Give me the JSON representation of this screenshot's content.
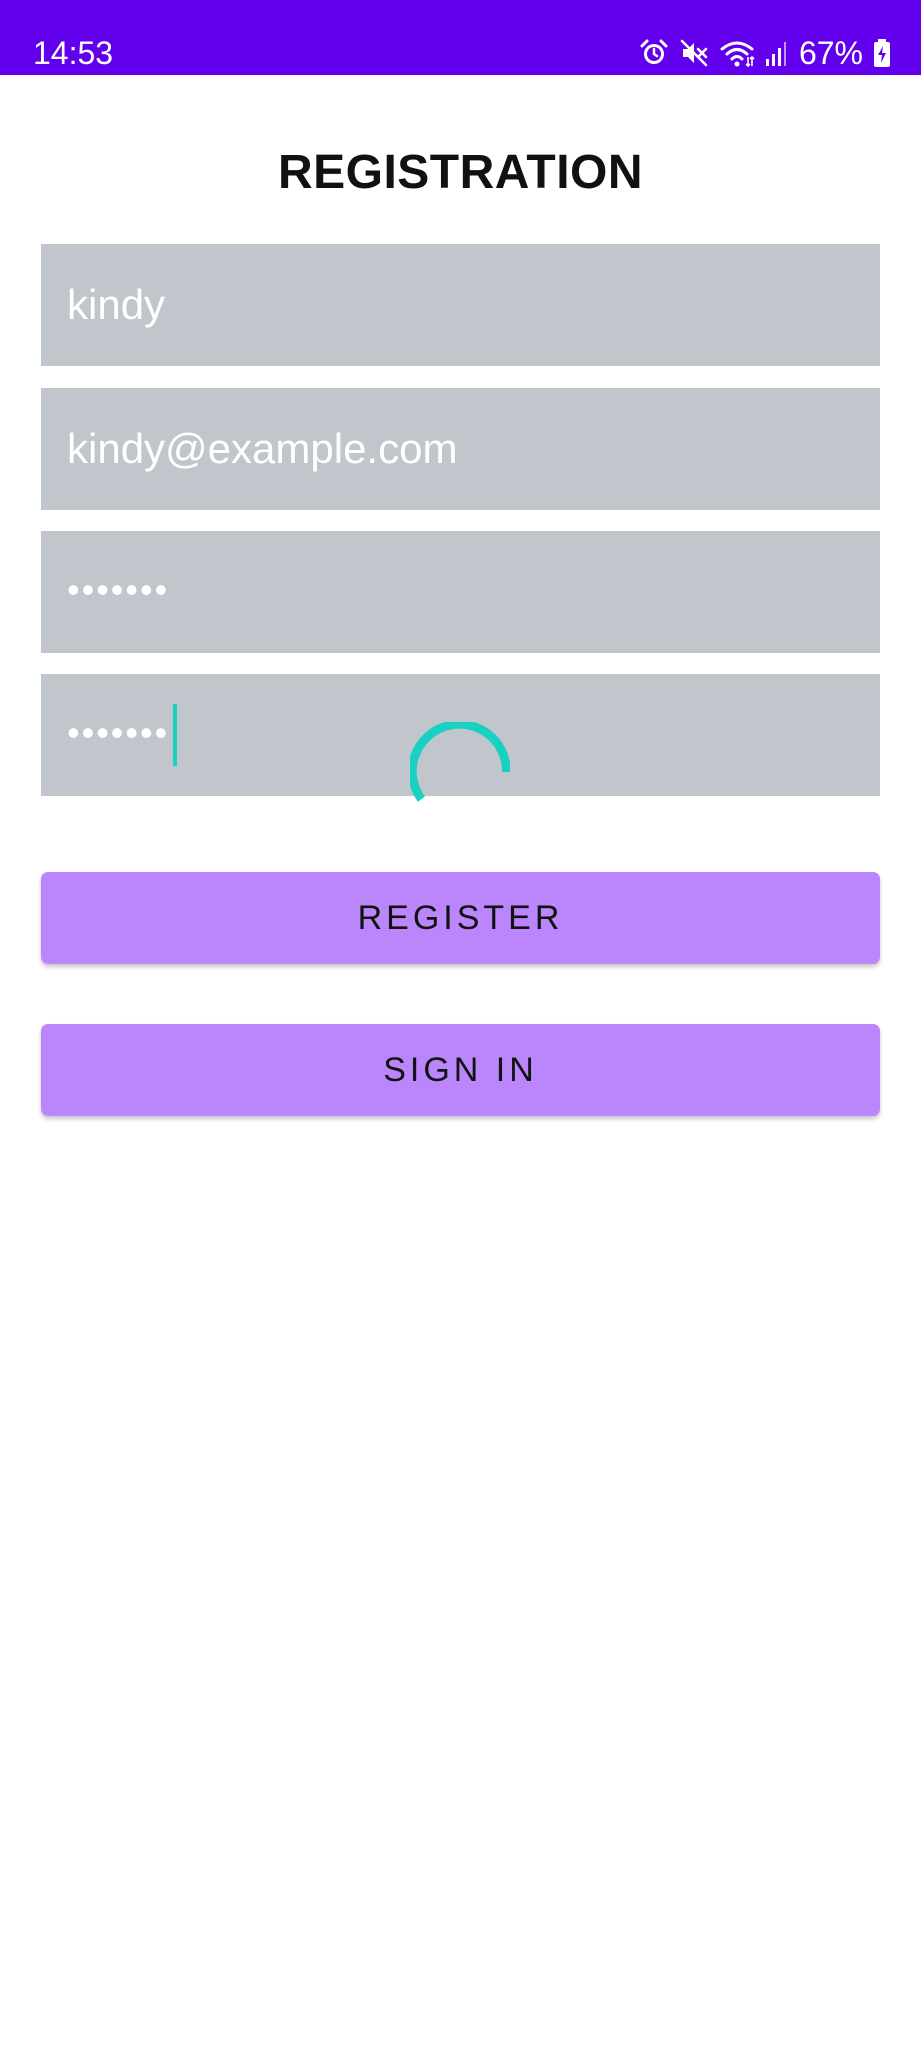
{
  "status_bar": {
    "time": "14:53",
    "battery": "67%",
    "icons": [
      "alarm-icon",
      "mute-icon",
      "wifi-icon",
      "signal-icon",
      "battery-icon"
    ],
    "background_color": "#6200ee"
  },
  "screen": {
    "title": "REGISTRATION"
  },
  "form": {
    "name_value": "kindy",
    "email_value": "kindy@example.com",
    "password_value": "•••••••",
    "confirm_password_value": "•••••••",
    "field_color": "#c1c6cc",
    "loading": true,
    "spinner_color": "#19d1c3"
  },
  "buttons": {
    "register_label": "REGISTER",
    "signin_label": "SIGN IN",
    "color": "#bb86fc"
  }
}
